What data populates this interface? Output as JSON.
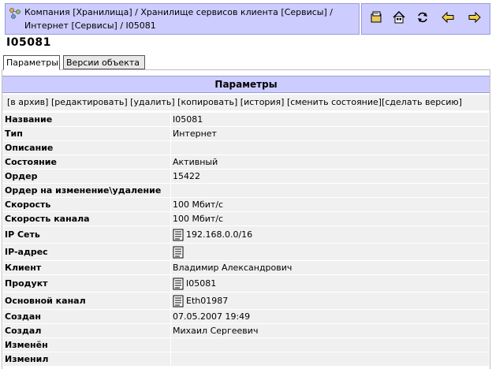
{
  "breadcrumb": {
    "part1": "Компания [Хранилища] / Хранилище сервисов клиента [Сервисы] /",
    "part2": "Интернет [Сервисы] / I05081"
  },
  "page_title": "I05081",
  "tabs": [
    {
      "label": "Параметры"
    },
    {
      "label": "Версии объекта"
    }
  ],
  "section_title": "Параметры",
  "actions": {
    "archive": "[в архив]",
    "edit": "[редактировать]",
    "delete": "[удалить]",
    "copy": "[копировать]",
    "history": "[история]",
    "change_state": "[сменить состояние]",
    "make_version": "[сделать версию]"
  },
  "rows": [
    {
      "label": "Название",
      "value": "I05081"
    },
    {
      "label": "Тип",
      "value": "Интернет"
    },
    {
      "label": "Описание",
      "value": ""
    },
    {
      "label": "Состояние",
      "value": "Активный"
    },
    {
      "label": "Ордер",
      "value": "15422"
    },
    {
      "label": "Ордер на изменение\\удаление",
      "value": ""
    },
    {
      "label": "Скорость",
      "value": "100 Мбит/с"
    },
    {
      "label": "Скорость канала",
      "value": "100 Мбит/с"
    },
    {
      "label": "IP Сеть",
      "value": "192.168.0.0/16"
    },
    {
      "label": "IP-адрес",
      "value": ""
    },
    {
      "label": "Клиент",
      "value": "Владимир Александрович"
    },
    {
      "label": "Продукт",
      "value": "I05081"
    },
    {
      "label": "Основной канал",
      "value": "Eth01987"
    },
    {
      "label": "Создан",
      "value": "07.05.2007 19:49"
    },
    {
      "label": "Создал",
      "value": "Михаил Сергеевич"
    },
    {
      "label": "Изменён",
      "value": ""
    },
    {
      "label": "Изменил",
      "value": ""
    }
  ],
  "icons": {
    "breadcrumb": "hierarchy-icon",
    "toolbar": [
      "folder-icon",
      "home-icon",
      "refresh-icon",
      "arrow-left-icon",
      "arrow-right-icon"
    ],
    "document": "document-icon"
  },
  "colors": {
    "header_bg": "#ccccff",
    "row_bg": "#f0f0f0"
  }
}
